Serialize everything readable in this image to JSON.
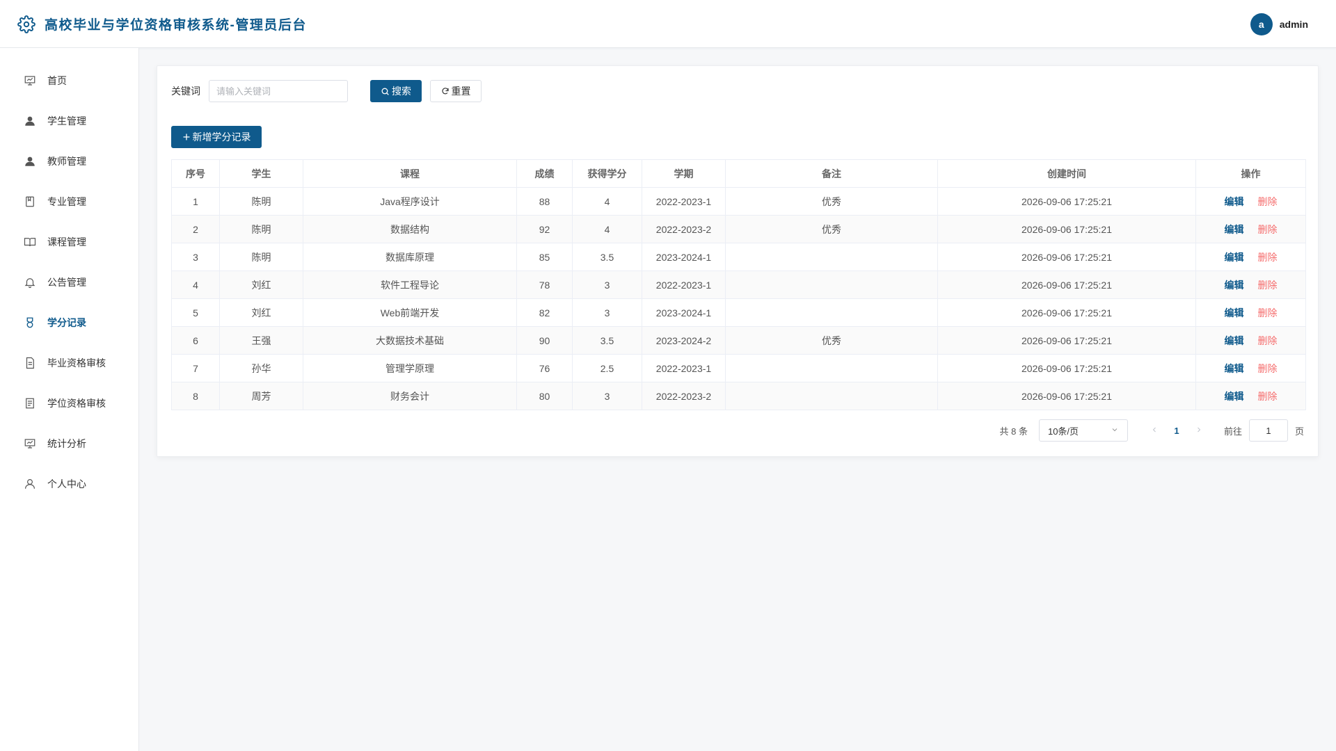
{
  "header": {
    "title": "高校毕业与学位资格审核系统-管理员后台",
    "avatar_letter": "a",
    "username": "admin",
    "brand_icon": "gear-icon",
    "accent_color": "#0f5a8c"
  },
  "sidebar": {
    "items": [
      {
        "label": "首页",
        "icon": "presentation-icon"
      },
      {
        "label": "学生管理",
        "icon": "user-icon"
      },
      {
        "label": "教师管理",
        "icon": "user-icon"
      },
      {
        "label": "专业管理",
        "icon": "notebook-icon"
      },
      {
        "label": "课程管理",
        "icon": "book-icon"
      },
      {
        "label": "公告管理",
        "icon": "bell-icon"
      },
      {
        "label": "学分记录",
        "icon": "medal-icon",
        "active": true
      },
      {
        "label": "毕业资格审核",
        "icon": "document-icon"
      },
      {
        "label": "学位资格审核",
        "icon": "list-document-icon"
      },
      {
        "label": "统计分析",
        "icon": "presentation-icon"
      },
      {
        "label": "个人中心",
        "icon": "user-outline-icon"
      }
    ]
  },
  "search": {
    "label": "关键词",
    "placeholder": "请输入关键词",
    "value": "",
    "search_button": "搜索",
    "reset_button": "重置"
  },
  "toolbar": {
    "add_button": "新增学分记录"
  },
  "table": {
    "headers": [
      "序号",
      "学生",
      "课程",
      "成绩",
      "获得学分",
      "学期",
      "备注",
      "创建时间",
      "操作"
    ],
    "rows": [
      {
        "no": "1",
        "student": "陈明",
        "course": "Java程序设计",
        "score": "88",
        "credit": "4",
        "term": "2022-2023-1",
        "remark": "优秀",
        "created": "2026-09-06 17:25:21"
      },
      {
        "no": "2",
        "student": "陈明",
        "course": "数据结构",
        "score": "92",
        "credit": "4",
        "term": "2022-2023-2",
        "remark": "优秀",
        "created": "2026-09-06 17:25:21"
      },
      {
        "no": "3",
        "student": "陈明",
        "course": "数据库原理",
        "score": "85",
        "credit": "3.5",
        "term": "2023-2024-1",
        "remark": "",
        "created": "2026-09-06 17:25:21"
      },
      {
        "no": "4",
        "student": "刘红",
        "course": "软件工程导论",
        "score": "78",
        "credit": "3",
        "term": "2022-2023-1",
        "remark": "",
        "created": "2026-09-06 17:25:21"
      },
      {
        "no": "5",
        "student": "刘红",
        "course": "Web前端开发",
        "score": "82",
        "credit": "3",
        "term": "2023-2024-1",
        "remark": "",
        "created": "2026-09-06 17:25:21"
      },
      {
        "no": "6",
        "student": "王强",
        "course": "大数据技术基础",
        "score": "90",
        "credit": "3.5",
        "term": "2023-2024-2",
        "remark": "优秀",
        "created": "2026-09-06 17:25:21"
      },
      {
        "no": "7",
        "student": "孙华",
        "course": "管理学原理",
        "score": "76",
        "credit": "2.5",
        "term": "2022-2023-1",
        "remark": "",
        "created": "2026-09-06 17:25:21"
      },
      {
        "no": "8",
        "student": "周芳",
        "course": "财务会计",
        "score": "80",
        "credit": "3",
        "term": "2022-2023-2",
        "remark": "",
        "created": "2026-09-06 17:25:21"
      }
    ],
    "edit_label": "编辑",
    "delete_label": "删除"
  },
  "pagination": {
    "total_text": "共 8 条",
    "page_size": "10条/页",
    "current_page": "1",
    "goto_label": "前往",
    "goto_value": "1",
    "goto_suffix": "页"
  }
}
